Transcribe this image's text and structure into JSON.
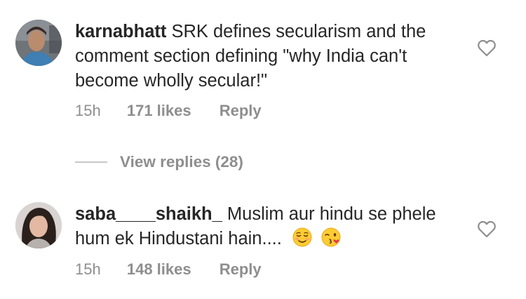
{
  "comments": [
    {
      "username": "karnabhatt",
      "text": "SRK defines secularism and the comment section defining \"why India can't become wholly secular!\"",
      "time": "15h",
      "likes": "171 likes",
      "reply_label": "Reply",
      "avatar_icon": "user-avatar-karnabhatt",
      "like_icon": "heart-outline-icon"
    },
    {
      "username": "saba____shaikh_",
      "text": "Muslim aur hindu se phele hum ek Hindustani hain....",
      "emojis": [
        "relieved-face-emoji",
        "face-blowing-kiss-emoji"
      ],
      "time": "15h",
      "likes": "148 likes",
      "reply_label": "Reply",
      "avatar_icon": "user-avatar-saba-shaikh",
      "like_icon": "heart-outline-icon"
    }
  ],
  "view_replies": {
    "label": "View replies (28)"
  },
  "colors": {
    "text": "#262626",
    "muted": "#8e8e8e",
    "divider": "#c7c7c7"
  }
}
